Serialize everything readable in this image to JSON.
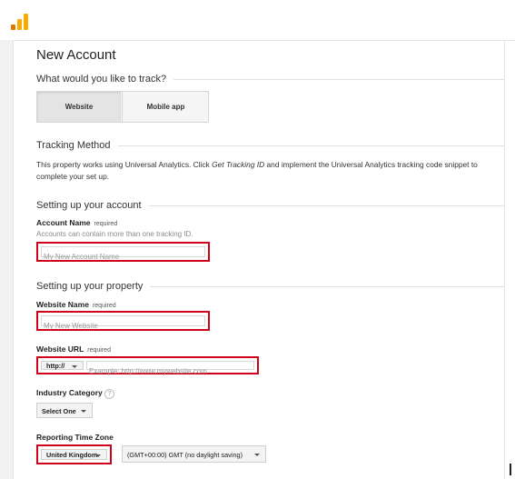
{
  "header": {
    "logo_icon": "analytics-logo-icon"
  },
  "page": {
    "title": "New Account",
    "track_question": "What would you like to track?",
    "tabs": [
      {
        "label": "Website",
        "selected": true
      },
      {
        "label": "Mobile app",
        "selected": false
      }
    ]
  },
  "tracking": {
    "heading": "Tracking Method",
    "text_before": "This property works using Universal Analytics. Click ",
    "emphasis": "Get Tracking ID",
    "text_after": " and implement the Universal Analytics tracking code snippet to complete your set up."
  },
  "account": {
    "heading": "Setting up your account",
    "name_label": "Account Name",
    "required": "required",
    "hint": "Accounts can contain more than one tracking ID.",
    "name_placeholder": "My New Account Name"
  },
  "property": {
    "heading": "Setting up your property",
    "website_name_label": "Website Name",
    "required": "required",
    "website_name_placeholder": "My New Website",
    "url_label": "Website URL",
    "protocol": "http://",
    "url_placeholder": "Example: http://www.mywebsite.com",
    "industry_label": "Industry Category",
    "industry_value": "Select One",
    "timezone_label": "Reporting Time Zone",
    "country_value": "United Kingdom",
    "timezone_value": "(GMT+00:00) GMT (no daylight saving)"
  },
  "colors": {
    "highlight_border": "#d0021b",
    "logo_orange": "#f9ab00",
    "logo_dark_orange": "#e37400"
  }
}
